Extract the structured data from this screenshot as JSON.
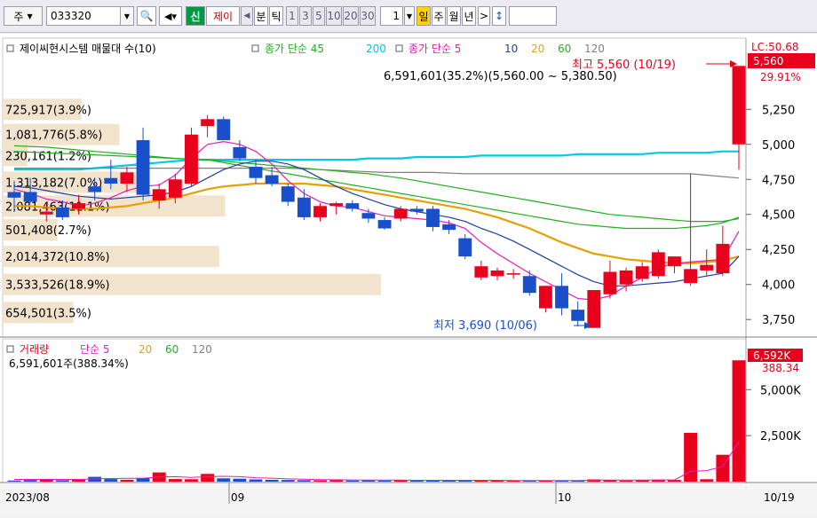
{
  "toolbar": {
    "period_select": "주",
    "code_value": "033320",
    "sin_label": "신",
    "name_label": "제이",
    "unit_minute": "분",
    "unit_tick": "틱",
    "numbers": [
      "1",
      "3",
      "5",
      "10",
      "20",
      "30"
    ],
    "count_value": "1",
    "tab_day": "일",
    "tab_week": "주",
    "tab_month": "월",
    "tab_year": "년",
    "next_label": ">"
  },
  "price_panel": {
    "legend_main": "제이씨현시스템 매물대 수(10)",
    "legend_ma_long": "종가 단순 45",
    "legend_ma_long2": "200",
    "legend_ma_short": "종가 단순 5",
    "legend_ma_10": "10",
    "legend_ma_20": "20",
    "legend_ma_60": "60",
    "legend_ma_120": "120",
    "summary_label": "6,591,601(35.2%)(5,560.00 ~ 5,380.50)",
    "high_label": "최고 5,560 (10/19)",
    "low_label": "최저 3,690 (10/06)",
    "current_price": "5,560",
    "right_stack_label": "LC:50.68",
    "right_stack_value": "29.91%"
  },
  "volume_panel": {
    "legend_title": "거래량",
    "legend_ma": "단순 5",
    "legend_20": "20",
    "legend_60": "60",
    "legend_120": "120",
    "legend_value": "6,591,601주(388.34%)",
    "current_volume": "6,592K",
    "current_ratio": "388.34"
  },
  "x_axis": {
    "labels": [
      "2023/08",
      "09",
      "10",
      "10/19"
    ]
  },
  "colors": {
    "up": "#e8001c",
    "down": "#1a4fcc",
    "ma5": "#e81ac0",
    "ma10": "#1e3ea0",
    "ma20": "#e8a000",
    "ma60": "#20b020",
    "ma120": "#808080",
    "ma200": "#00c8e8",
    "ma45": "#20b020",
    "vp_bar": "#f2e3cc"
  },
  "chart_data": [
    {
      "type": "candlestick",
      "title": "제이씨현시스템",
      "ylim": [
        3650,
        5600
      ],
      "y_ticks": [
        3750,
        4000,
        4250,
        4500,
        4750,
        5000,
        5250
      ],
      "candles": [
        {
          "o": 4660,
          "h": 4740,
          "l": 4520,
          "c": 4620
        },
        {
          "o": 4660,
          "h": 4760,
          "l": 4580,
          "c": 4590
        },
        {
          "o": 4500,
          "h": 4580,
          "l": 4450,
          "c": 4520
        },
        {
          "o": 4550,
          "h": 4600,
          "l": 4460,
          "c": 4480
        },
        {
          "o": 4540,
          "h": 4640,
          "l": 4500,
          "c": 4580
        },
        {
          "o": 4700,
          "h": 4760,
          "l": 4600,
          "c": 4660
        },
        {
          "o": 4760,
          "h": 4890,
          "l": 4680,
          "c": 4720
        },
        {
          "o": 4720,
          "h": 4840,
          "l": 4660,
          "c": 4800
        },
        {
          "o": 5030,
          "h": 5120,
          "l": 4600,
          "c": 4640
        },
        {
          "o": 4600,
          "h": 4720,
          "l": 4540,
          "c": 4680
        },
        {
          "o": 4620,
          "h": 4790,
          "l": 4580,
          "c": 4750
        },
        {
          "o": 4720,
          "h": 5120,
          "l": 4700,
          "c": 5070
        },
        {
          "o": 5130,
          "h": 5210,
          "l": 5050,
          "c": 5180
        },
        {
          "o": 5180,
          "h": 5200,
          "l": 5030,
          "c": 5030
        },
        {
          "o": 4980,
          "h": 5030,
          "l": 4880,
          "c": 4900
        },
        {
          "o": 4840,
          "h": 4890,
          "l": 4720,
          "c": 4760
        },
        {
          "o": 4780,
          "h": 4840,
          "l": 4700,
          "c": 4720
        },
        {
          "o": 4700,
          "h": 4720,
          "l": 4560,
          "c": 4590
        },
        {
          "o": 4620,
          "h": 4680,
          "l": 4460,
          "c": 4480
        },
        {
          "o": 4480,
          "h": 4580,
          "l": 4450,
          "c": 4560
        },
        {
          "o": 4560,
          "h": 4590,
          "l": 4500,
          "c": 4580
        },
        {
          "o": 4580,
          "h": 4600,
          "l": 4520,
          "c": 4540
        },
        {
          "o": 4510,
          "h": 4540,
          "l": 4440,
          "c": 4470
        },
        {
          "o": 4460,
          "h": 4480,
          "l": 4390,
          "c": 4400
        },
        {
          "o": 4470,
          "h": 4560,
          "l": 4450,
          "c": 4540
        },
        {
          "o": 4540,
          "h": 4560,
          "l": 4500,
          "c": 4520
        },
        {
          "o": 4540,
          "h": 4560,
          "l": 4380,
          "c": 4410
        },
        {
          "o": 4430,
          "h": 4460,
          "l": 4360,
          "c": 4390
        },
        {
          "o": 4330,
          "h": 4360,
          "l": 4180,
          "c": 4200
        },
        {
          "o": 4050,
          "h": 4170,
          "l": 4030,
          "c": 4130
        },
        {
          "o": 4060,
          "h": 4120,
          "l": 4030,
          "c": 4100
        },
        {
          "o": 4070,
          "h": 4110,
          "l": 4040,
          "c": 4080
        },
        {
          "o": 4060,
          "h": 4100,
          "l": 3920,
          "c": 3940
        },
        {
          "o": 3830,
          "h": 3990,
          "l": 3800,
          "c": 3990
        },
        {
          "o": 3990,
          "h": 4080,
          "l": 3780,
          "c": 3830
        },
        {
          "o": 3820,
          "h": 3880,
          "l": 3700,
          "c": 3740
        },
        {
          "o": 3690,
          "h": 3960,
          "l": 3690,
          "c": 3960
        },
        {
          "o": 3930,
          "h": 4170,
          "l": 3900,
          "c": 4090
        },
        {
          "o": 4000,
          "h": 4120,
          "l": 3950,
          "c": 4100
        },
        {
          "o": 4040,
          "h": 4160,
          "l": 4020,
          "c": 4130
        },
        {
          "o": 4060,
          "h": 4250,
          "l": 4040,
          "c": 4230
        },
        {
          "o": 4130,
          "h": 4200,
          "l": 4080,
          "c": 4200
        },
        {
          "o": 4010,
          "h": 4790,
          "l": 3990,
          "c": 4110
        },
        {
          "o": 4100,
          "h": 4250,
          "l": 4060,
          "c": 4140
        },
        {
          "o": 4080,
          "h": 4420,
          "l": 4060,
          "c": 4290
        },
        {
          "o": 5000,
          "h": 5560,
          "l": 4820,
          "c": 5560
        }
      ],
      "ma5": [
        4680,
        4650,
        4610,
        4590,
        4560,
        4580,
        4620,
        4670,
        4700,
        4710,
        4780,
        4900,
        5000,
        5020,
        5000,
        4950,
        4860,
        4740,
        4650,
        4590,
        4560,
        4550,
        4520,
        4490,
        4480,
        4470,
        4460,
        4440,
        4400,
        4300,
        4220,
        4150,
        4080,
        4020,
        3960,
        3900,
        3890,
        3920,
        3990,
        4050,
        4120,
        4150,
        4160,
        4170,
        4180,
        4380
      ],
      "ma10": [
        4700,
        4690,
        4670,
        4650,
        4630,
        4620,
        4610,
        4620,
        4630,
        4640,
        4660,
        4700,
        4760,
        4820,
        4860,
        4880,
        4880,
        4860,
        4820,
        4760,
        4700,
        4650,
        4610,
        4570,
        4540,
        4520,
        4500,
        4480,
        4450,
        4400,
        4360,
        4310,
        4250,
        4190,
        4130,
        4070,
        4020,
        3990,
        3990,
        4000,
        4010,
        4020,
        4040,
        4060,
        4080,
        4200
      ],
      "ma20": [
        4560,
        4560,
        4550,
        4540,
        4540,
        4540,
        4550,
        4560,
        4580,
        4600,
        4620,
        4650,
        4680,
        4700,
        4710,
        4720,
        4720,
        4720,
        4720,
        4710,
        4700,
        4680,
        4660,
        4640,
        4620,
        4600,
        4580,
        4560,
        4540,
        4510,
        4480,
        4440,
        4400,
        4350,
        4300,
        4260,
        4220,
        4200,
        4180,
        4170,
        4160,
        4150,
        4150,
        4160,
        4170,
        4200
      ],
      "ma60": [
        4950,
        4945,
        4940,
        4935,
        4930,
        4925,
        4920,
        4915,
        4910,
        4905,
        4900,
        4895,
        4890,
        4880,
        4870,
        4860,
        4850,
        4840,
        4830,
        4820,
        4810,
        4800,
        4790,
        4775,
        4760,
        4740,
        4720,
        4700,
        4680,
        4660,
        4640,
        4620,
        4600,
        4580,
        4560,
        4540,
        4520,
        4500,
        4490,
        4480,
        4470,
        4460,
        4450,
        4450,
        4450,
        4470
      ],
      "ma45": [
        4990,
        4985,
        4980,
        4970,
        4960,
        4950,
        4940,
        4930,
        4920,
        4910,
        4900,
        4895,
        4890,
        4870,
        4850,
        4830,
        4810,
        4790,
        4770,
        4750,
        4730,
        4710,
        4690,
        4670,
        4650,
        4630,
        4610,
        4590,
        4570,
        4550,
        4530,
        4510,
        4490,
        4470,
        4450,
        4430,
        4420,
        4410,
        4400,
        4400,
        4400,
        4400,
        4410,
        4420,
        4440,
        4480
      ],
      "ma120": [
        4830,
        4830,
        4830,
        4830,
        4830,
        4830,
        4830,
        4830,
        4830,
        4830,
        4830,
        4830,
        4830,
        4830,
        4830,
        4830,
        4830,
        4830,
        4825,
        4820,
        4815,
        4810,
        4805,
        4800,
        4800,
        4800,
        4800,
        4795,
        4790,
        4790,
        4790,
        4790,
        4790,
        4790,
        4790,
        4790,
        4790,
        4790,
        4790,
        4790,
        4790,
        4790,
        4790,
        4780,
        4770,
        4760
      ],
      "ma200": [
        4820,
        4820,
        4820,
        4820,
        4820,
        4830,
        4840,
        4850,
        4860,
        4870,
        4880,
        4890,
        4890,
        4890,
        4890,
        4890,
        4890,
        4890,
        4890,
        4890,
        4890,
        4890,
        4900,
        4900,
        4900,
        4910,
        4910,
        4910,
        4910,
        4920,
        4920,
        4920,
        4920,
        4920,
        4920,
        4930,
        4930,
        4930,
        4930,
        4930,
        4940,
        4940,
        4940,
        4940,
        4950,
        4950
      ],
      "volume_profile": [
        {
          "label": "725,917(3.9%)",
          "price": 5250,
          "pct": 3.9
        },
        {
          "label": "1,081,776(5.8%)",
          "price": 5070,
          "pct": 5.8
        },
        {
          "label": "230,161(1.2%)",
          "price": 4920,
          "pct": 1.2
        },
        {
          "label": "1,313,182(7.0%)",
          "price": 4730,
          "pct": 7.0
        },
        {
          "label": "2,081,463(11.1%)",
          "price": 4560,
          "pct": 11.1
        },
        {
          "label": "501,408(2.7%)",
          "price": 4390,
          "pct": 2.7
        },
        {
          "label": "2,014,372(10.8%)",
          "price": 4200,
          "pct": 10.8
        },
        {
          "label": "3,533,526(18.9%)",
          "price": 4000,
          "pct": 18.9
        },
        {
          "label": "654,501(3.5%)",
          "price": 3800,
          "pct": 3.5
        }
      ]
    },
    {
      "type": "bar",
      "title": "거래량",
      "ylim": [
        0,
        6700
      ],
      "y_ticks": [
        2500,
        5000
      ],
      "y_tick_labels": [
        "2,500K",
        "5,000K"
      ],
      "volumes_k": [
        60,
        90,
        120,
        80,
        110,
        260,
        140,
        100,
        200,
        500,
        140,
        130,
        420,
        180,
        160,
        120,
        100,
        90,
        80,
        70,
        80,
        60,
        70,
        60,
        80,
        70,
        60,
        60,
        70,
        60,
        60,
        50,
        60,
        60,
        70,
        60,
        120,
        80,
        60,
        70,
        110,
        90,
        2650,
        130,
        1460,
        6592
      ],
      "vol_ma5_k": [
        120,
        120,
        120,
        120,
        120,
        150,
        170,
        180,
        180,
        250,
        270,
        230,
        270,
        290,
        270,
        210,
        190,
        150,
        130,
        110,
        100,
        90,
        80,
        80,
        80,
        70,
        70,
        70,
        70,
        70,
        70,
        60,
        60,
        60,
        60,
        60,
        80,
        80,
        80,
        80,
        90,
        90,
        560,
        600,
        820,
        2180
      ]
    }
  ]
}
